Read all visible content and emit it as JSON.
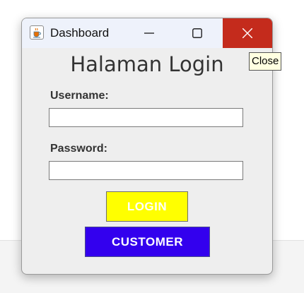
{
  "window": {
    "title": "Dashboard",
    "app_icon": "java-cup-icon",
    "controls": {
      "minimize_icon": "minimize-icon",
      "maximize_icon": "maximize-icon",
      "close_icon": "close-icon"
    }
  },
  "tooltip": {
    "text": "Close"
  },
  "form": {
    "heading": "Halaman Login",
    "username_label": "Username:",
    "username_value": "",
    "password_label": "Password:",
    "password_value": "",
    "login_button": "LOGIN",
    "customer_button": "CUSTOMER"
  },
  "colors": {
    "close_button": "#c42b1c",
    "login_button": "#ffff00",
    "customer_button": "#3300ee",
    "window_background": "#eeeeee",
    "tooltip_background": "#ffffe1"
  }
}
